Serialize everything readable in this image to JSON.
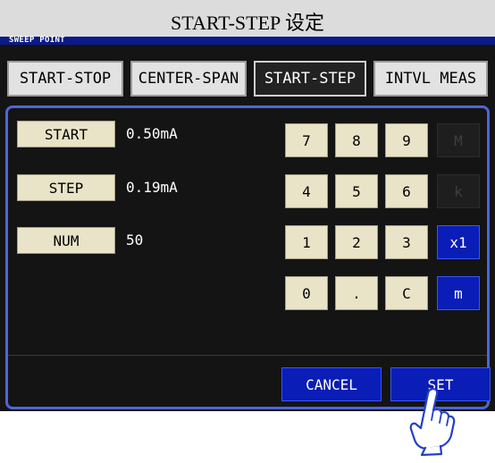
{
  "header": {
    "title": "START-STEP 设定",
    "section_label": "SWEEP POINT"
  },
  "tabs": [
    {
      "label": "START-STOP",
      "active": false
    },
    {
      "label": "CENTER-SPAN",
      "active": false
    },
    {
      "label": "START-STEP",
      "active": true
    },
    {
      "label": "INTVL MEAS",
      "active": false
    }
  ],
  "params": [
    {
      "label": "START",
      "value": "0.50mA"
    },
    {
      "label": "STEP",
      "value": "0.19mA"
    },
    {
      "label": "NUM",
      "value": "50"
    }
  ],
  "keypad": {
    "digits": [
      "7",
      "8",
      "9",
      "4",
      "5",
      "6",
      "1",
      "2",
      "3",
      "0",
      ".",
      "C"
    ],
    "units": [
      {
        "label": "M",
        "state": "disabled"
      },
      {
        "label": "k",
        "state": "disabled"
      },
      {
        "label": "x1",
        "state": "selected"
      },
      {
        "label": "m",
        "state": "enabled"
      }
    ]
  },
  "actions": {
    "cancel_label": "CANCEL",
    "set_label": "SET"
  },
  "icons": {
    "pointer": "pointing-hand-icon"
  },
  "colors": {
    "accent_blue": "#0a1db6",
    "header_stripe": "#0b1a8c",
    "panel_border": "#4d66d6",
    "screen_bg": "#141414",
    "button_face": "#e9e3c8"
  }
}
